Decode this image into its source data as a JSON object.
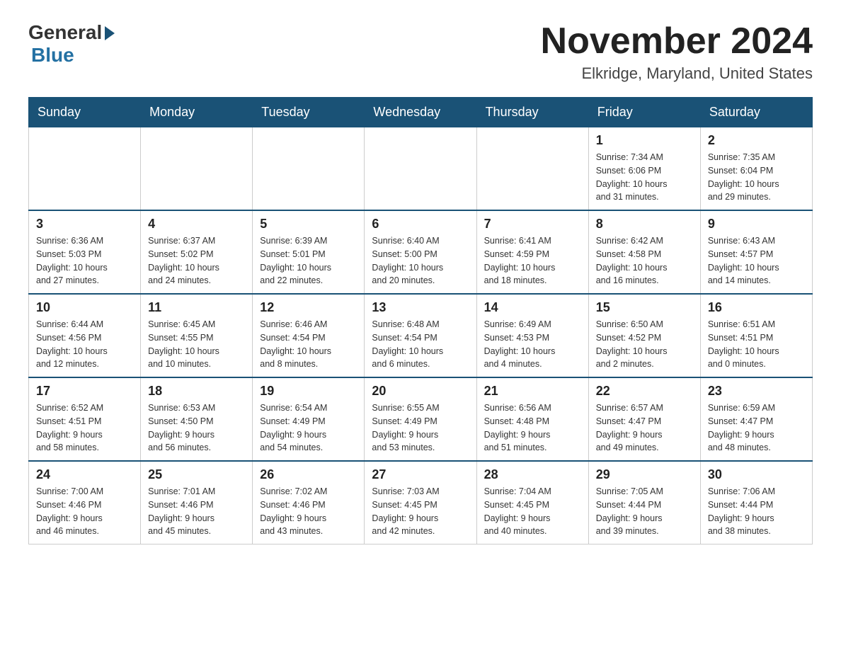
{
  "header": {
    "logo_general": "General",
    "logo_blue": "Blue",
    "month_title": "November 2024",
    "location": "Elkridge, Maryland, United States"
  },
  "days_of_week": [
    "Sunday",
    "Monday",
    "Tuesday",
    "Wednesday",
    "Thursday",
    "Friday",
    "Saturday"
  ],
  "weeks": [
    [
      {
        "day": "",
        "info": ""
      },
      {
        "day": "",
        "info": ""
      },
      {
        "day": "",
        "info": ""
      },
      {
        "day": "",
        "info": ""
      },
      {
        "day": "",
        "info": ""
      },
      {
        "day": "1",
        "info": "Sunrise: 7:34 AM\nSunset: 6:06 PM\nDaylight: 10 hours\nand 31 minutes."
      },
      {
        "day": "2",
        "info": "Sunrise: 7:35 AM\nSunset: 6:04 PM\nDaylight: 10 hours\nand 29 minutes."
      }
    ],
    [
      {
        "day": "3",
        "info": "Sunrise: 6:36 AM\nSunset: 5:03 PM\nDaylight: 10 hours\nand 27 minutes."
      },
      {
        "day": "4",
        "info": "Sunrise: 6:37 AM\nSunset: 5:02 PM\nDaylight: 10 hours\nand 24 minutes."
      },
      {
        "day": "5",
        "info": "Sunrise: 6:39 AM\nSunset: 5:01 PM\nDaylight: 10 hours\nand 22 minutes."
      },
      {
        "day": "6",
        "info": "Sunrise: 6:40 AM\nSunset: 5:00 PM\nDaylight: 10 hours\nand 20 minutes."
      },
      {
        "day": "7",
        "info": "Sunrise: 6:41 AM\nSunset: 4:59 PM\nDaylight: 10 hours\nand 18 minutes."
      },
      {
        "day": "8",
        "info": "Sunrise: 6:42 AM\nSunset: 4:58 PM\nDaylight: 10 hours\nand 16 minutes."
      },
      {
        "day": "9",
        "info": "Sunrise: 6:43 AM\nSunset: 4:57 PM\nDaylight: 10 hours\nand 14 minutes."
      }
    ],
    [
      {
        "day": "10",
        "info": "Sunrise: 6:44 AM\nSunset: 4:56 PM\nDaylight: 10 hours\nand 12 minutes."
      },
      {
        "day": "11",
        "info": "Sunrise: 6:45 AM\nSunset: 4:55 PM\nDaylight: 10 hours\nand 10 minutes."
      },
      {
        "day": "12",
        "info": "Sunrise: 6:46 AM\nSunset: 4:54 PM\nDaylight: 10 hours\nand 8 minutes."
      },
      {
        "day": "13",
        "info": "Sunrise: 6:48 AM\nSunset: 4:54 PM\nDaylight: 10 hours\nand 6 minutes."
      },
      {
        "day": "14",
        "info": "Sunrise: 6:49 AM\nSunset: 4:53 PM\nDaylight: 10 hours\nand 4 minutes."
      },
      {
        "day": "15",
        "info": "Sunrise: 6:50 AM\nSunset: 4:52 PM\nDaylight: 10 hours\nand 2 minutes."
      },
      {
        "day": "16",
        "info": "Sunrise: 6:51 AM\nSunset: 4:51 PM\nDaylight: 10 hours\nand 0 minutes."
      }
    ],
    [
      {
        "day": "17",
        "info": "Sunrise: 6:52 AM\nSunset: 4:51 PM\nDaylight: 9 hours\nand 58 minutes."
      },
      {
        "day": "18",
        "info": "Sunrise: 6:53 AM\nSunset: 4:50 PM\nDaylight: 9 hours\nand 56 minutes."
      },
      {
        "day": "19",
        "info": "Sunrise: 6:54 AM\nSunset: 4:49 PM\nDaylight: 9 hours\nand 54 minutes."
      },
      {
        "day": "20",
        "info": "Sunrise: 6:55 AM\nSunset: 4:49 PM\nDaylight: 9 hours\nand 53 minutes."
      },
      {
        "day": "21",
        "info": "Sunrise: 6:56 AM\nSunset: 4:48 PM\nDaylight: 9 hours\nand 51 minutes."
      },
      {
        "day": "22",
        "info": "Sunrise: 6:57 AM\nSunset: 4:47 PM\nDaylight: 9 hours\nand 49 minutes."
      },
      {
        "day": "23",
        "info": "Sunrise: 6:59 AM\nSunset: 4:47 PM\nDaylight: 9 hours\nand 48 minutes."
      }
    ],
    [
      {
        "day": "24",
        "info": "Sunrise: 7:00 AM\nSunset: 4:46 PM\nDaylight: 9 hours\nand 46 minutes."
      },
      {
        "day": "25",
        "info": "Sunrise: 7:01 AM\nSunset: 4:46 PM\nDaylight: 9 hours\nand 45 minutes."
      },
      {
        "day": "26",
        "info": "Sunrise: 7:02 AM\nSunset: 4:46 PM\nDaylight: 9 hours\nand 43 minutes."
      },
      {
        "day": "27",
        "info": "Sunrise: 7:03 AM\nSunset: 4:45 PM\nDaylight: 9 hours\nand 42 minutes."
      },
      {
        "day": "28",
        "info": "Sunrise: 7:04 AM\nSunset: 4:45 PM\nDaylight: 9 hours\nand 40 minutes."
      },
      {
        "day": "29",
        "info": "Sunrise: 7:05 AM\nSunset: 4:44 PM\nDaylight: 9 hours\nand 39 minutes."
      },
      {
        "day": "30",
        "info": "Sunrise: 7:06 AM\nSunset: 4:44 PM\nDaylight: 9 hours\nand 38 minutes."
      }
    ]
  ]
}
